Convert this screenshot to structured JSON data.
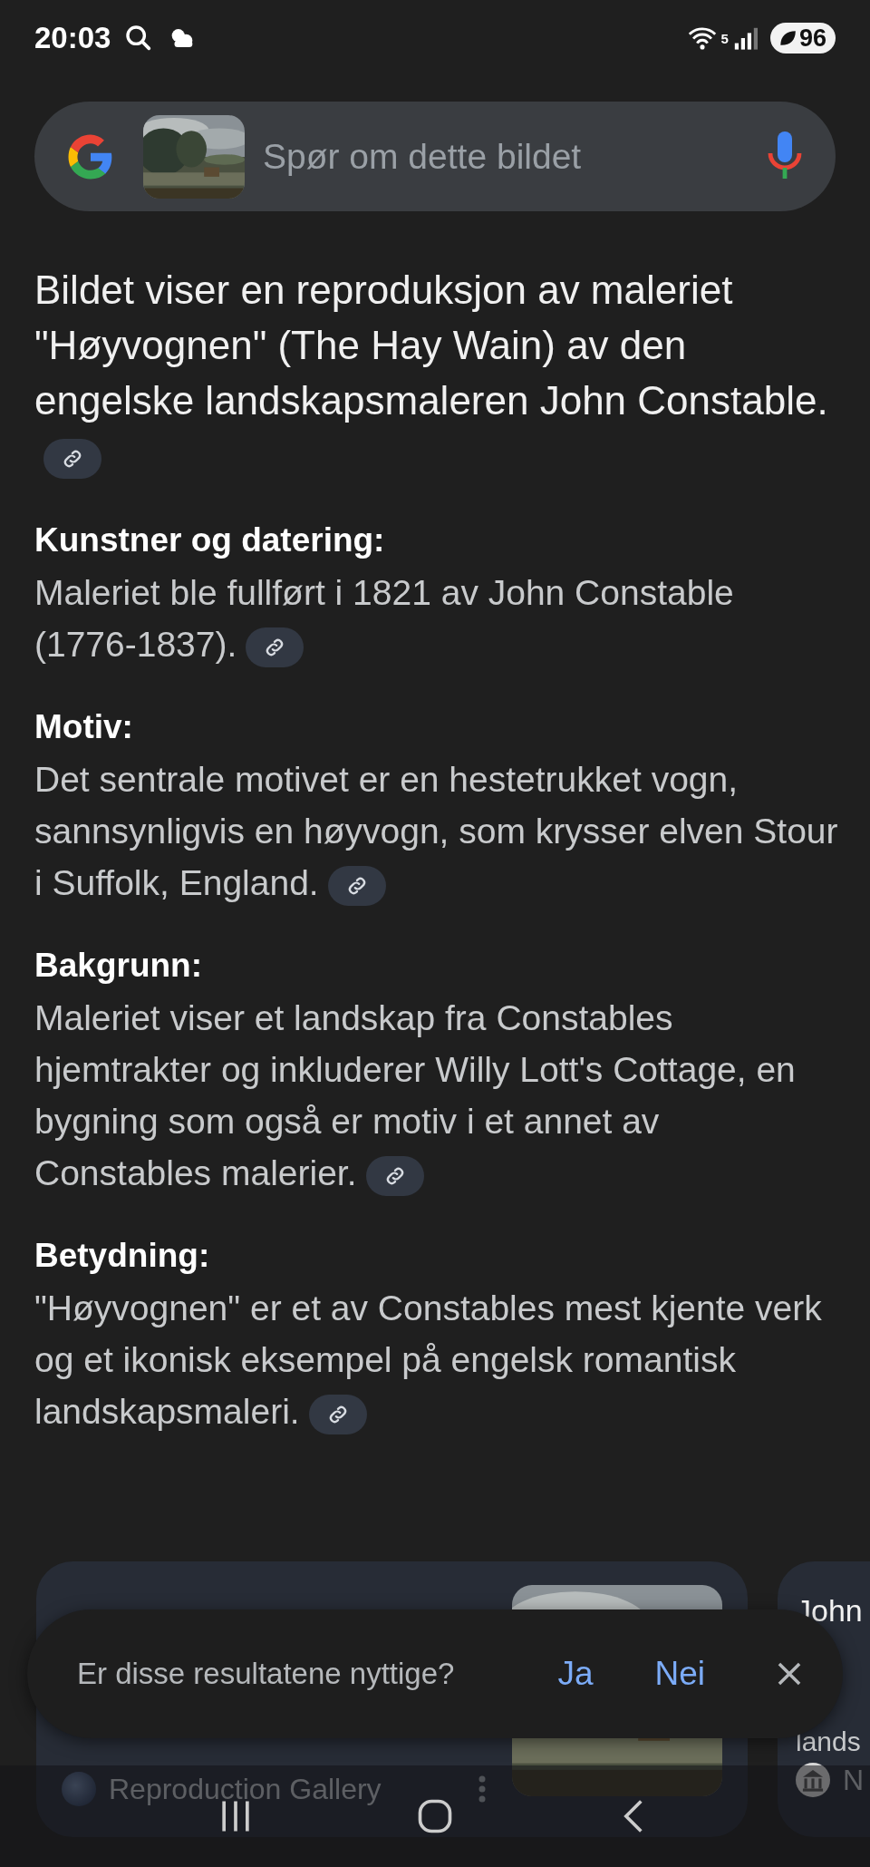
{
  "status_bar": {
    "time": "20:03",
    "network": "5",
    "battery": "96"
  },
  "search": {
    "placeholder": "Spør om dette bildet"
  },
  "answer": {
    "intro": "Bildet viser en reproduksjon av maleriet \"Høyvognen\" (The Hay Wain) av den engelske landskapsmaleren John Constable.",
    "sections": [
      {
        "heading": "Kunstner og datering:",
        "text": "Maleriet ble fullført i 1821 av John Constable (1776-1837)."
      },
      {
        "heading": "Motiv:",
        "text": "Det sentrale motivet er en hestetrukket vogn, sannsynligvis en høyvogn, som krysser elven Stour i Suffolk, England."
      },
      {
        "heading": "Bakgrunn:",
        "text": "Maleriet viser et landskap fra Constables hjemtrakter og inkluderer Willy Lott's Cottage, en bygning som også er motiv i et annet av Constables malerier."
      },
      {
        "heading": "Betydning:",
        "text": "\"Høyvognen\" er et av Constables mest kjente verk og et ikonisk eksempel på engelsk romantisk landskapsmaleri."
      }
    ]
  },
  "cards": [
    {
      "source": "Reproduction Gallery"
    },
    {
      "title": "John",
      "snippet": "lands",
      "source": "N"
    }
  ],
  "feedback": {
    "question": "Er disse resultatene nyttige?",
    "yes": "Ja",
    "no": "Nei"
  }
}
